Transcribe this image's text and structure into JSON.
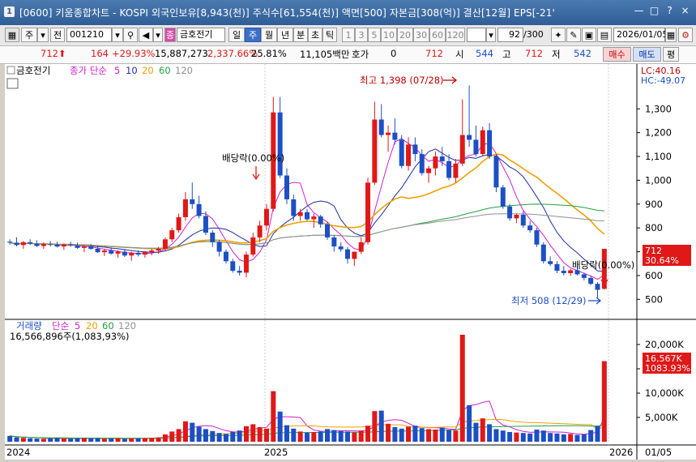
{
  "window": {
    "title": "[0600] 키움종합차트 - KOSPI 외국인보유[8,943(천)] 주식수[61,554(천)] 액면[500] 자본금[308(억)] 결산[12월] EPS[-21'",
    "buttons": [
      "—",
      "□",
      "?",
      "×"
    ]
  },
  "toolbar": {
    "market": "주",
    "mode": "전",
    "code": "001210",
    "stock_name": "금호전기",
    "periods": [
      "일",
      "주",
      "월",
      "년"
    ],
    "active_period": "주",
    "intraday": [
      "분",
      "초",
      "틱"
    ],
    "intervals": [
      "1",
      "3",
      "5",
      "10",
      "20",
      "30",
      "60",
      "120"
    ],
    "count": "92",
    "count_max": "/300",
    "date": "2026/01/05"
  },
  "quote": {
    "price": "712",
    "change": "164",
    "change_pct": "+29.93%",
    "volume": "15,887,273",
    "volume_ratio": "2,337.66%",
    "turnover": "25.81%",
    "amount": "11,105백만",
    "hoga_label": "호가",
    "hoga_value": "0",
    "hoga_price": "712",
    "open_label": "시",
    "open": "544",
    "high_label": "고",
    "high": "712",
    "low_label": "저",
    "low": "542",
    "buy_label": "매수",
    "sell_label": "매도",
    "eval_label": "평"
  },
  "legend": {
    "stock": "금호전기",
    "ma_label": "종가 단순",
    "ma5": "5",
    "ma10": "10",
    "ma20": "20",
    "ma60": "60",
    "ma120": "120",
    "lc": "LC:40.16",
    "hc": "HC:-49.07",
    "vol_label": "거래량",
    "vol_ma_label": "단순",
    "vol_info": "16,566,896주(1,083,93%)"
  },
  "annotations": {
    "high": "최고 1,398 (07/28)",
    "low": "최저 508 (12/29)",
    "div1": "배당락(0.00%)",
    "div2": "배당락(0.00%)",
    "price_tag": "712",
    "price_tag_pct": "30.64%",
    "vol_tag": "16,567K",
    "vol_tag_pct": "1083.93%"
  },
  "x_labels": [
    "2024",
    "2025",
    "2026",
    "01/05"
  ],
  "colors": {
    "up": "#e01818",
    "down": "#1c4fc4",
    "ma5": "#d020d0",
    "ma10": "#2030a0",
    "ma20": "#f0a000",
    "ma60": "#20a040",
    "ma120": "#909090",
    "titlebar": "#3a68a3"
  },
  "chart_data": {
    "type": "candlestick",
    "price_axis": {
      "ticks": [
        500,
        600,
        700,
        800,
        900,
        1000,
        1100,
        1200,
        1300
      ],
      "range": [
        450,
        1420
      ]
    },
    "volume_axis": {
      "ticks": [
        "5,000K",
        "10,000K",
        "15,000K",
        "20,000K"
      ],
      "range_k": [
        0,
        24000
      ]
    },
    "x": [
      "2024",
      "2025",
      "2026"
    ],
    "ohlc": [
      [
        742,
        752,
        730,
        738
      ],
      [
        738,
        760,
        722,
        728
      ],
      [
        728,
        745,
        712,
        740
      ],
      [
        740,
        752,
        728,
        734
      ],
      [
        734,
        748,
        720,
        724
      ],
      [
        724,
        740,
        712,
        732
      ],
      [
        732,
        745,
        722,
        730
      ],
      [
        730,
        742,
        718,
        722
      ],
      [
        722,
        735,
        708,
        730
      ],
      [
        730,
        742,
        720,
        726
      ],
      [
        726,
        738,
        712,
        716
      ],
      [
        716,
        728,
        698,
        722
      ],
      [
        722,
        732,
        708,
        712
      ],
      [
        712,
        726,
        695,
        698
      ],
      [
        698,
        712,
        682,
        705
      ],
      [
        705,
        718,
        688,
        692
      ],
      [
        692,
        706,
        675,
        700
      ],
      [
        700,
        712,
        678,
        684
      ],
      [
        684,
        700,
        662,
        695
      ],
      [
        695,
        706,
        680,
        688
      ],
      [
        688,
        702,
        675,
        698
      ],
      [
        698,
        712,
        685,
        705
      ],
      [
        705,
        720,
        692,
        712
      ],
      [
        712,
        760,
        705,
        752
      ],
      [
        752,
        800,
        740,
        790
      ],
      [
        790,
        860,
        780,
        845
      ],
      [
        845,
        950,
        830,
        920
      ],
      [
        920,
        990,
        880,
        900
      ],
      [
        900,
        935,
        840,
        850
      ],
      [
        850,
        870,
        770,
        780
      ],
      [
        780,
        790,
        720,
        740
      ],
      [
        740,
        750,
        680,
        700
      ],
      [
        700,
        710,
        650,
        660
      ],
      [
        660,
        670,
        612,
        620
      ],
      [
        620,
        640,
        600,
        612
      ],
      [
        612,
        700,
        592,
        688
      ],
      [
        688,
        780,
        680,
        760
      ],
      [
        760,
        830,
        740,
        810
      ],
      [
        810,
        900,
        790,
        880
      ],
      [
        880,
        1350,
        870,
        1285
      ],
      [
        1285,
        1350,
        1010,
        1020
      ],
      [
        1020,
        1050,
        900,
        920
      ],
      [
        920,
        940,
        830,
        850
      ],
      [
        850,
        880,
        830,
        866
      ],
      [
        866,
        880,
        830,
        836
      ],
      [
        836,
        860,
        800,
        848
      ],
      [
        848,
        855,
        800,
        815
      ],
      [
        815,
        825,
        750,
        760
      ],
      [
        760,
        770,
        700,
        722
      ],
      [
        722,
        740,
        700,
        710
      ],
      [
        710,
        720,
        650,
        670
      ],
      [
        670,
        690,
        640,
        700
      ],
      [
        700,
        760,
        690,
        740
      ],
      [
        740,
        1010,
        730,
        990
      ],
      [
        990,
        1330,
        980,
        1255
      ],
      [
        1255,
        1320,
        1180,
        1190
      ],
      [
        1190,
        1230,
        1120,
        1200
      ],
      [
        1200,
        1260,
        1150,
        1170
      ],
      [
        1170,
        1190,
        1050,
        1060
      ],
      [
        1060,
        1180,
        1040,
        1150
      ],
      [
        1150,
        1180,
        1080,
        1110
      ],
      [
        1110,
        1130,
        1020,
        1030
      ],
      [
        1030,
        1060,
        990,
        1050
      ],
      [
        1050,
        1120,
        1020,
        1100
      ],
      [
        1100,
        1140,
        1060,
        1080
      ],
      [
        1080,
        1110,
        1000,
        1010
      ],
      [
        1010,
        1090,
        990,
        1070
      ],
      [
        1070,
        1340,
        1060,
        1190
      ],
      [
        1190,
        1398,
        1140,
        1170
      ],
      [
        1170,
        1230,
        1100,
        1110
      ],
      [
        1110,
        1225,
        1100,
        1210
      ],
      [
        1210,
        1240,
        1090,
        1100
      ],
      [
        1100,
        1110,
        950,
        970
      ],
      [
        970,
        980,
        880,
        890
      ],
      [
        890,
        900,
        830,
        840
      ],
      [
        840,
        860,
        820,
        855
      ],
      [
        855,
        870,
        800,
        810
      ],
      [
        810,
        830,
        780,
        790
      ],
      [
        790,
        800,
        720,
        730
      ],
      [
        730,
        740,
        650,
        660
      ],
      [
        660,
        680,
        640,
        648
      ],
      [
        648,
        660,
        610,
        620
      ],
      [
        620,
        640,
        600,
        610
      ],
      [
        610,
        628,
        598,
        622
      ],
      [
        622,
        640,
        600,
        605
      ],
      [
        605,
        612,
        580,
        590
      ],
      [
        590,
        600,
        560,
        565
      ],
      [
        565,
        572,
        508,
        540
      ],
      [
        544,
        712,
        542,
        712
      ]
    ],
    "volume_k": [
      1200,
      900,
      800,
      700,
      650,
      600,
      700,
      800,
      650,
      600,
      700,
      750,
      650,
      700,
      600,
      650,
      700,
      600,
      650,
      700,
      750,
      800,
      900,
      1500,
      2100,
      2600,
      4200,
      3900,
      3100,
      2600,
      2200,
      1800,
      1600,
      2000,
      2300,
      3200,
      3600,
      3000,
      2700,
      10400,
      6200,
      3400,
      2700,
      2100,
      1900,
      2000,
      2100,
      2600,
      2400,
      2200,
      2100,
      1900,
      2300,
      3300,
      6300,
      6400,
      3700,
      3000,
      2700,
      3100,
      3300,
      2800,
      2600,
      2500,
      2900,
      2400,
      2300,
      22000,
      7500,
      3900,
      4800,
      3600,
      2600,
      2300,
      2000,
      1900,
      1800,
      1700,
      2500,
      2300,
      1800,
      1700,
      1500,
      1600,
      1400,
      1500,
      2400,
      3200,
      16567
    ]
  }
}
